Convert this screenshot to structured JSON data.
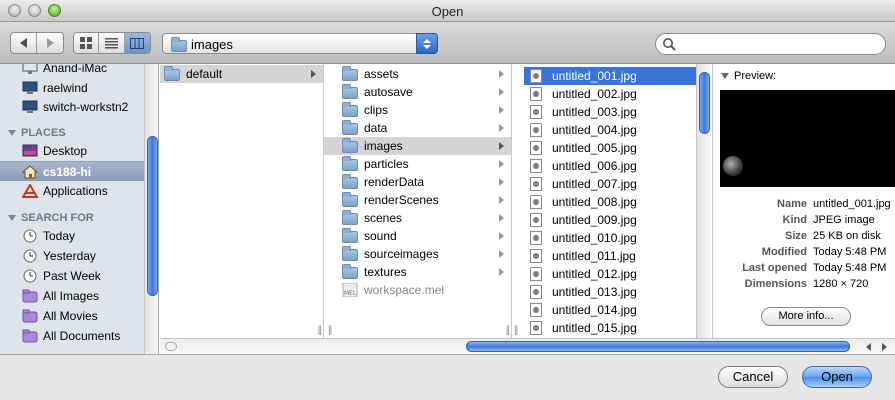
{
  "window": {
    "title": "Open"
  },
  "toolbar": {
    "path_popup": "images",
    "search": {
      "value": "",
      "placeholder": ""
    }
  },
  "sidebar": {
    "devices": [
      {
        "label": "Anand-iMac",
        "icon": "imac-icon"
      },
      {
        "label": "raelwind",
        "icon": "monitor-icon"
      },
      {
        "label": "switch-workstn2",
        "icon": "monitor-icon"
      }
    ],
    "places_header": "PLACES",
    "places": [
      {
        "label": "Desktop",
        "icon": "desktop-icon"
      },
      {
        "label": "cs188-hi",
        "icon": "home-icon"
      },
      {
        "label": "Applications",
        "icon": "applications-icon"
      }
    ],
    "search_header": "SEARCH FOR",
    "search_for": [
      {
        "label": "Today",
        "icon": "clock-icon"
      },
      {
        "label": "Yesterday",
        "icon": "clock-icon"
      },
      {
        "label": "Past Week",
        "icon": "clock-icon"
      },
      {
        "label": "All Images",
        "icon": "smart-folder-icon"
      },
      {
        "label": "All Movies",
        "icon": "smart-folder-icon"
      },
      {
        "label": "All Documents",
        "icon": "smart-folder-icon"
      }
    ]
  },
  "column1": {
    "items": [
      "default"
    ]
  },
  "column2": {
    "items": [
      "assets",
      "autosave",
      "clips",
      "data",
      "images",
      "particles",
      "renderData",
      "renderScenes",
      "scenes",
      "sound",
      "sourceimages",
      "textures"
    ],
    "file": "workspace.mel"
  },
  "column3": {
    "items": [
      "untitled_001.jpg",
      "untitled_002.jpg",
      "untitled_003.jpg",
      "untitled_004.jpg",
      "untitled_005.jpg",
      "untitled_006.jpg",
      "untitled_007.jpg",
      "untitled_008.jpg",
      "untitled_009.jpg",
      "untitled_010.jpg",
      "untitled_011.jpg",
      "untitled_012.jpg",
      "untitled_013.jpg",
      "untitled_014.jpg",
      "untitled_015.jpg"
    ]
  },
  "preview": {
    "header": "Preview:",
    "fields": [
      {
        "key": "Name",
        "value": "untitled_001.jpg"
      },
      {
        "key": "Kind",
        "value": "JPEG image"
      },
      {
        "key": "Size",
        "value": "25 KB on disk"
      },
      {
        "key": "Modified",
        "value": "Today 5:48 PM"
      },
      {
        "key": "Last opened",
        "value": "Today 5:48 PM"
      },
      {
        "key": "Dimensions",
        "value": "1280 × 720"
      }
    ],
    "more_info": "More info..."
  },
  "buttons": {
    "cancel": "Cancel",
    "open": "Open"
  }
}
